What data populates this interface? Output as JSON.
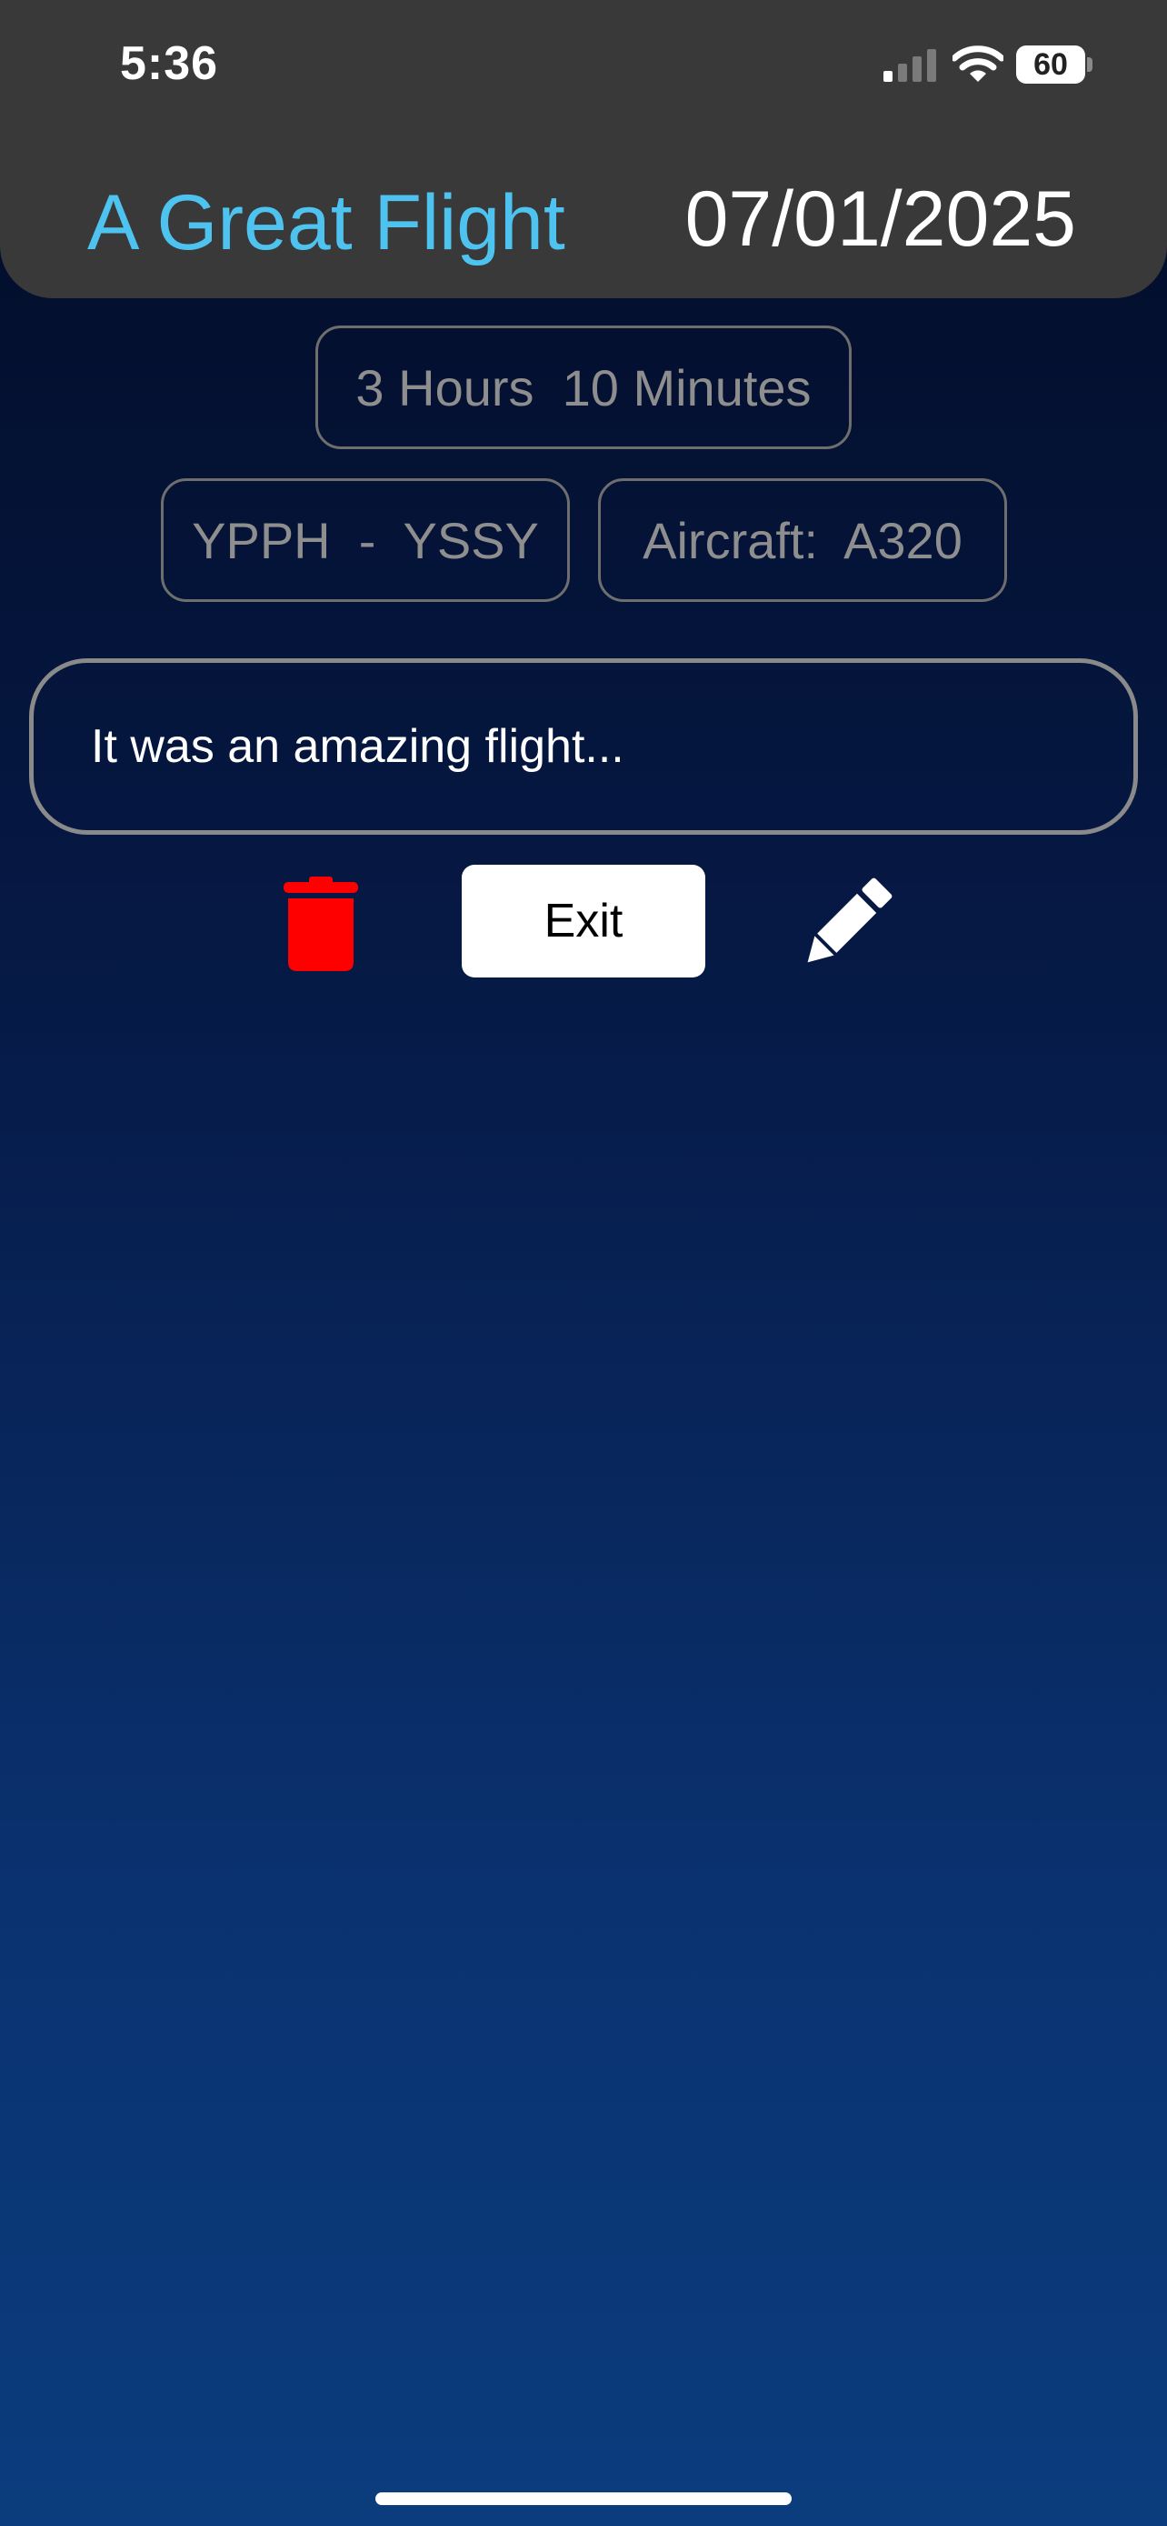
{
  "status_bar": {
    "time": "5:36",
    "battery_level": "60",
    "signal_bars_active": 1,
    "signal_bars_total": 4
  },
  "header": {
    "title": "A Great Flight",
    "date": "07/01/2025",
    "title_color": "#4fc3f0"
  },
  "details": {
    "duration": "3 Hours  10 Minutes",
    "route": "YPPH  -  YSSY",
    "aircraft": "Aircraft:  A320"
  },
  "notes": {
    "text": "It was an amazing flight..."
  },
  "actions": {
    "exit_label": "Exit",
    "delete_icon": "trash-icon",
    "edit_icon": "pencil-icon",
    "delete_color": "#ff0000"
  }
}
